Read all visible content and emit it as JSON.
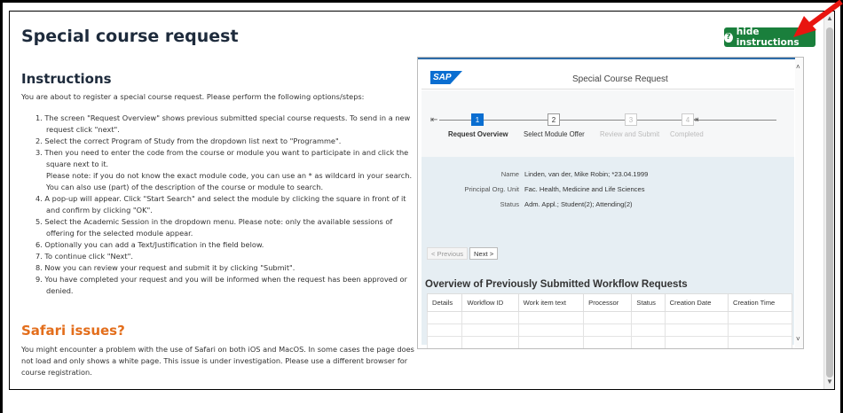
{
  "page": {
    "title": "Special course request",
    "hide_button_label": "hide instructions"
  },
  "instructions": {
    "heading": "Instructions",
    "intro": "You are about to register a special course request. Please perform the following options/steps:",
    "steps": [
      "1. The screen \"Request Overview\" shows previous submitted special course requests. To send in a new request click \"next\".",
      "2. Select the correct Program of Study from the dropdown list next to \"Programme\".",
      "3. Then you need to enter the code from the course or module you want to participate in and click the square next to it.",
      "Please note: if you do not know the exact module code, you can use an * as wildcard in your search. You can also use (part) of the description of the course or module to search.",
      "4. A pop-up will appear. Click \"Start Search\" and select the module by clicking the square in front of it and confirm by clicking \"OK\".",
      "5. Select the Academic Session in the dropdown menu. Please note: only the available sessions of offering for the selected module appear.",
      "6. Optionally you can add a Text/Justification in the field below.",
      "7. To continue click \"Next\".",
      "8. Now you can review your request and submit it by clicking \"Submit\".",
      "9. You have completed your request and you will be informed when the request has been approved or denied."
    ]
  },
  "safari": {
    "heading": "Safari issues?",
    "text": "You might encounter a problem with the use of Safari on both iOS and MacOS. In some cases the page does not load and only shows a white page. This issue is under investigation. Please use a different browser for course registration."
  },
  "sap": {
    "logo": "SAP",
    "title": "Special Course Request",
    "roadmap": [
      {
        "num": "1",
        "label": "Request Overview",
        "state": "active"
      },
      {
        "num": "2",
        "label": "Select Module Offer",
        "state": "normal"
      },
      {
        "num": "3",
        "label": "Review and Submit",
        "state": "disabled"
      },
      {
        "num": "4",
        "label": "Completed",
        "state": "disabled"
      }
    ],
    "info": {
      "name_label": "Name",
      "name_value": "Linden, van der, Mike Robin; *23.04.1999",
      "org_label": "Principal Org. Unit",
      "org_value": "Fac. Health, Medicine and Life Sciences",
      "status_label": "Status",
      "status_value": "Adm. Appl.; Student(2); Attending(2)"
    },
    "prev_label": "< Previous",
    "next_label": "Next >",
    "workflow_title": "Overview of Previously Submitted Workflow Requests",
    "columns": [
      "Details",
      "Workflow ID",
      "Work item text",
      "Processor",
      "Status",
      "Creation Date",
      "Creation Time"
    ]
  },
  "colors": {
    "accent_green": "#1a7f3c",
    "title_navy": "#1e2b3c",
    "safari_orange": "#e36e1c",
    "sap_blue": "#0a6ed1",
    "annotation_red": "#e8140f"
  },
  "icons": {
    "hide_button": "question-circle-icon",
    "annotation": "red-arrow-icon"
  }
}
